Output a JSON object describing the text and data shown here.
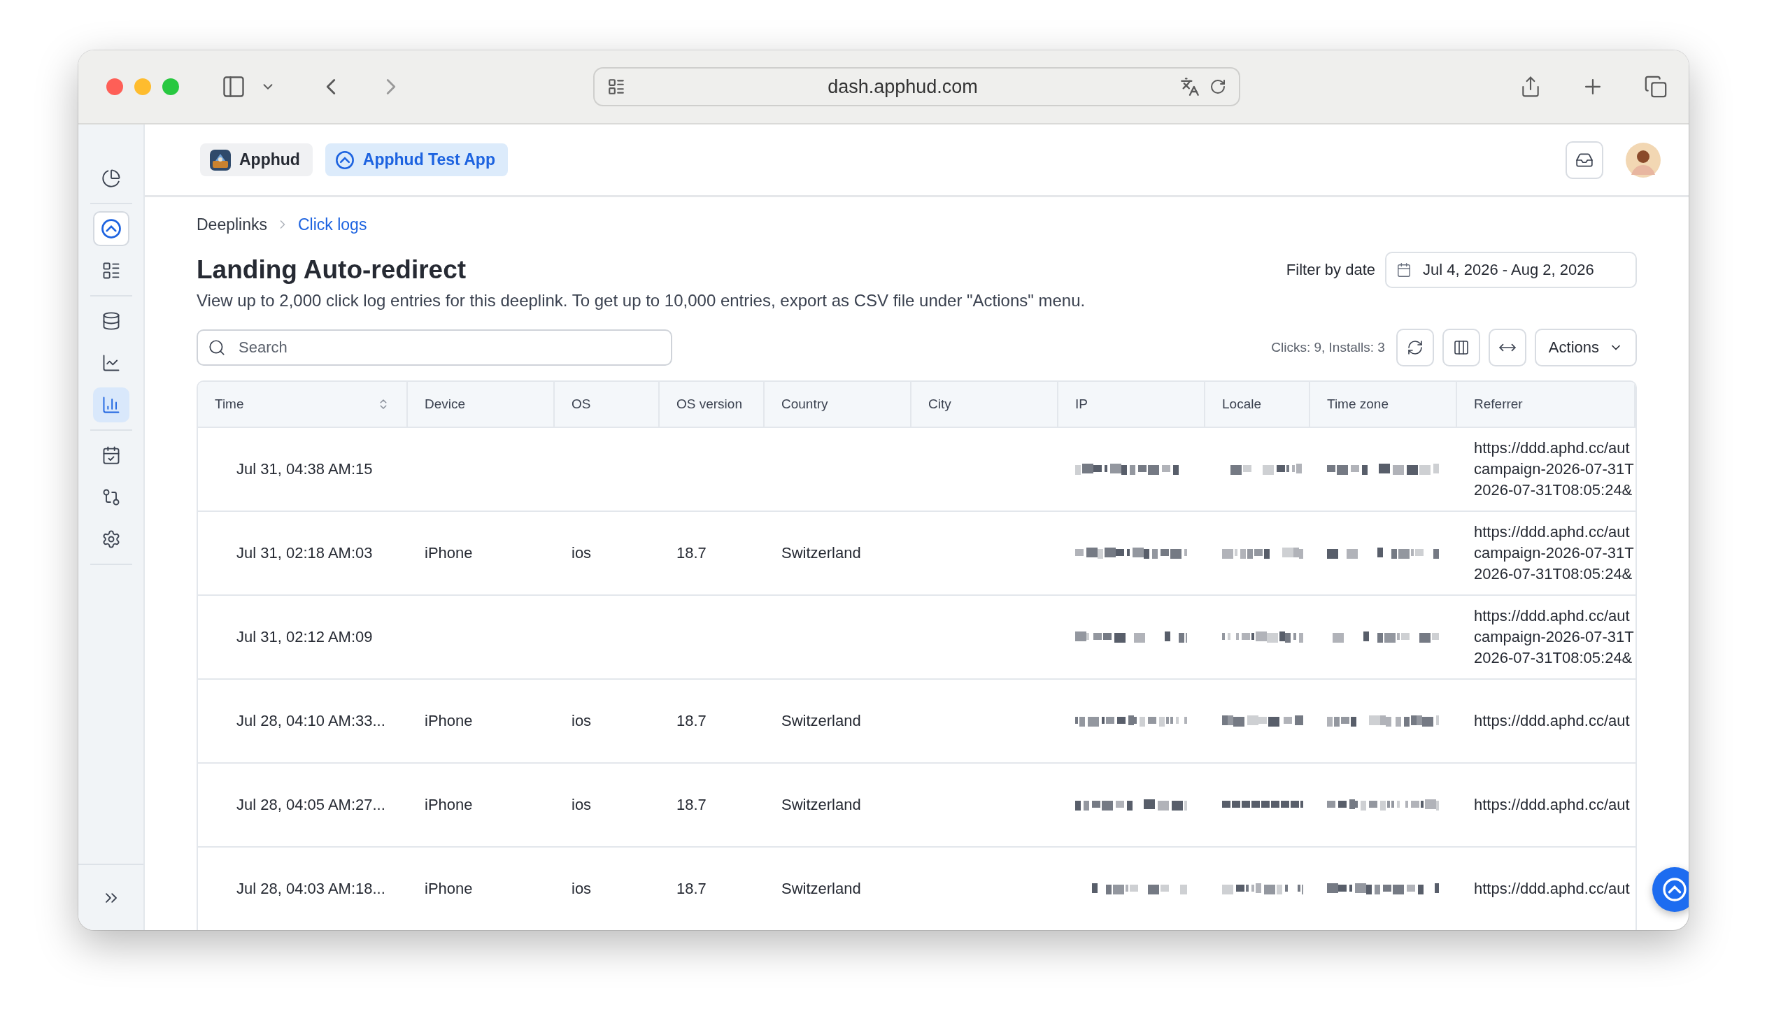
{
  "browser": {
    "url": "dash.apphud.com"
  },
  "sidebar": {
    "groups": [
      [
        {
          "selected": false
        }
      ],
      [
        {
          "selected": false
        },
        {
          "selected": false
        }
      ],
      [
        {
          "selected": false
        },
        {
          "selected": false
        },
        {
          "selected": true
        }
      ],
      [
        {
          "selected": false
        },
        {
          "selected": false
        },
        {
          "selected": false
        }
      ]
    ]
  },
  "workspace": {
    "chips": [
      {
        "label": "Apphud",
        "selected": false
      },
      {
        "label": "Apphud Test App",
        "selected": true
      }
    ]
  },
  "breadcrumbs": [
    {
      "label": "Deeplinks",
      "current": false
    },
    {
      "label": "Click logs",
      "current": true
    }
  ],
  "title": "Landing Auto-redirect",
  "description": "View up to 2,000 click log entries for this deeplink. To get up to 10,000 entries, export as CSV file under \"Actions\" menu.",
  "filter": {
    "label": "Filter by date",
    "value": "Jul 4, 2026 - Aug 2, 2026"
  },
  "search": {
    "placeholder": "Search"
  },
  "summary": "Clicks: 9, Installs: 3",
  "actions_button": "Actions",
  "table": {
    "columns": [
      {
        "label": "Time",
        "sortable": true
      },
      {
        "label": "Device",
        "sortable": false
      },
      {
        "label": "OS",
        "sortable": false
      },
      {
        "label": "OS version",
        "sortable": false
      },
      {
        "label": "Country",
        "sortable": false
      },
      {
        "label": "City",
        "sortable": false
      },
      {
        "label": "IP",
        "sortable": false
      },
      {
        "label": "Locale",
        "sortable": false
      },
      {
        "label": "Time zone",
        "sortable": false
      },
      {
        "label": "Referrer",
        "sortable": false
      }
    ],
    "rows": [
      {
        "time": "Jul 31, 04:38 AM:15",
        "redacted": true,
        "referrer": [
          "https://ddd.aphd.cc/aut",
          "campaign-2026-07-31T",
          "2026-07-31T08:05:24&"
        ]
      },
      {
        "time": "Jul 31, 02:18 AM:03",
        "device": "iPhone",
        "os": "ios",
        "os_version": "18.7",
        "country": "Switzerland",
        "redacted": true,
        "referrer": [
          "https://ddd.aphd.cc/aut",
          "campaign-2026-07-31T",
          "2026-07-31T08:05:24&"
        ]
      },
      {
        "time": "Jul 31, 02:12 AM:09",
        "redacted": true,
        "referrer": [
          "https://ddd.aphd.cc/aut",
          "campaign-2026-07-31T",
          "2026-07-31T08:05:24&"
        ]
      },
      {
        "time": "Jul 28, 04:10 AM:33...",
        "device": "iPhone",
        "os": "ios",
        "os_version": "18.7",
        "country": "Switzerland",
        "redacted": true,
        "referrer": [
          "https://ddd.aphd.cc/aut"
        ]
      },
      {
        "time": "Jul 28, 04:05 AM:27...",
        "device": "iPhone",
        "os": "ios",
        "os_version": "18.7",
        "country": "Switzerland",
        "redacted": true,
        "referrer": [
          "https://ddd.aphd.cc/aut"
        ]
      },
      {
        "time": "Jul 28, 04:03 AM:18...",
        "device": "iPhone",
        "os": "ios",
        "os_version": "18.7",
        "country": "Switzerland",
        "redacted": true,
        "referrer": [
          "https://ddd.aphd.cc/aut"
        ]
      }
    ]
  }
}
